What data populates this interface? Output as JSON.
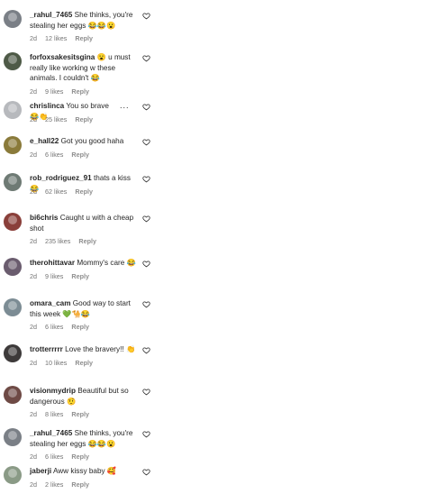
{
  "comments": [
    {
      "username": "_rahul_7465",
      "text": "She thinks, you're stealing her eggs 😂😂😮",
      "time": "2d",
      "likes": "12 likes",
      "reply": "Reply",
      "avatar_color": "#7a7f86"
    },
    {
      "username": "forfoxsakesitsgina",
      "text": "😮 u must really like working w these animals. I couldn't 😂",
      "time": "2d",
      "likes": "9 likes",
      "reply": "Reply",
      "avatar_color": "#4e5a47"
    },
    {
      "username": "chrislinca",
      "text": "You so brave 😂👏",
      "time": "2d",
      "likes": "25 likes",
      "reply": "Reply",
      "avatar_color": "#b7b9bd",
      "more": "..."
    },
    {
      "username": "e_hall22",
      "text": "Got you good haha",
      "time": "2d",
      "likes": "6 likes",
      "reply": "Reply",
      "avatar_color": "#8a7a3a"
    },
    {
      "username": "rob_rodriguez_91",
      "text": "thats a kiss😂",
      "time": "2d",
      "likes": "62 likes",
      "reply": "Reply",
      "avatar_color": "#6e7a74"
    },
    {
      "username": "bi6chris",
      "text": "Caught u with a cheap shot",
      "time": "2d",
      "likes": "235 likes",
      "reply": "Reply",
      "avatar_color": "#8a3f3a"
    },
    {
      "username": "therohittavar",
      "text": "Mommy's care 😂",
      "time": "2d",
      "likes": "9 likes",
      "reply": "Reply",
      "avatar_color": "#6a5c6e"
    },
    {
      "username": "omara_cam",
      "text": "Good way to start this week 💚🐪😂",
      "time": "2d",
      "likes": "6 likes",
      "reply": "Reply",
      "avatar_color": "#7c8c94"
    },
    {
      "username": "trotterrrrr",
      "text": "Love the bravery!! 👏",
      "time": "2d",
      "likes": "10 likes",
      "reply": "Reply",
      "avatar_color": "#3d3a3a"
    },
    {
      "username": "visionmydrip",
      "text": "Beautiful but so dangerous 🤨",
      "time": "2d",
      "likes": "8 likes",
      "reply": "Reply",
      "avatar_color": "#6e4a45"
    },
    {
      "username": "_rahul_7465",
      "text": "She thinks, you're stealing her eggs 😂😂😮",
      "time": "2d",
      "likes": "6 likes",
      "reply": "Reply",
      "avatar_color": "#7a7f86"
    },
    {
      "username": "jaberji",
      "text": "Aww kissy baby 🥰",
      "time": "2d",
      "likes": "2 likes",
      "reply": "Reply",
      "avatar_color": "#8a9a86"
    }
  ]
}
